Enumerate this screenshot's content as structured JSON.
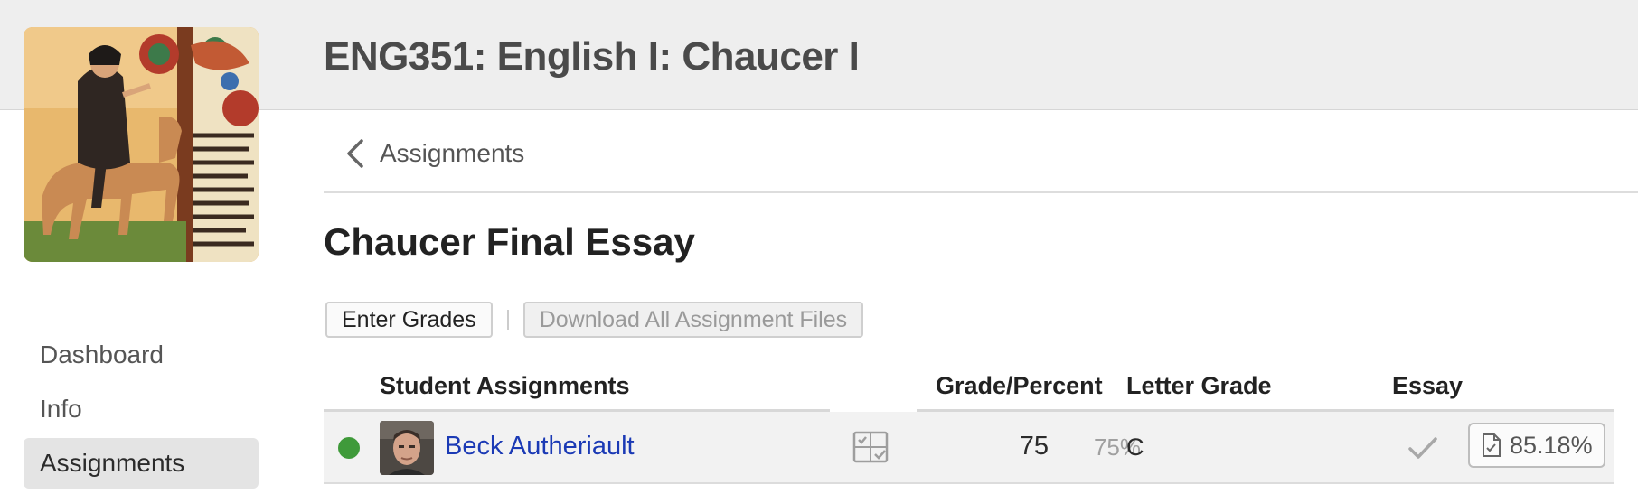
{
  "course": {
    "title": "ENG351: English I: Chaucer I"
  },
  "nav": {
    "items": [
      {
        "label": "Dashboard",
        "active": false
      },
      {
        "label": "Info",
        "active": false
      },
      {
        "label": "Assignments",
        "active": true
      }
    ]
  },
  "breadcrumb": {
    "label": "Assignments",
    "icon": "chevron-left-icon"
  },
  "assignment": {
    "title": "Chaucer Final Essay"
  },
  "toolbar": {
    "enter_grades_label": "Enter Grades",
    "download_label": "Download All Assignment Files"
  },
  "table": {
    "headers": {
      "student": "Student Assignments",
      "grade": "Grade/Percent",
      "letter": "Letter Grade",
      "essay": "Essay"
    },
    "rows": [
      {
        "name": "Beck Autheriault",
        "grade": "75",
        "percent": "75%",
        "letter": "C",
        "essay_score": "85.18%",
        "status_color": "#3f9a3a"
      }
    ]
  },
  "colors": {
    "link": "#1b3ab5",
    "status_ok": "#3f9a3a",
    "header_band": "#eeeeee"
  }
}
